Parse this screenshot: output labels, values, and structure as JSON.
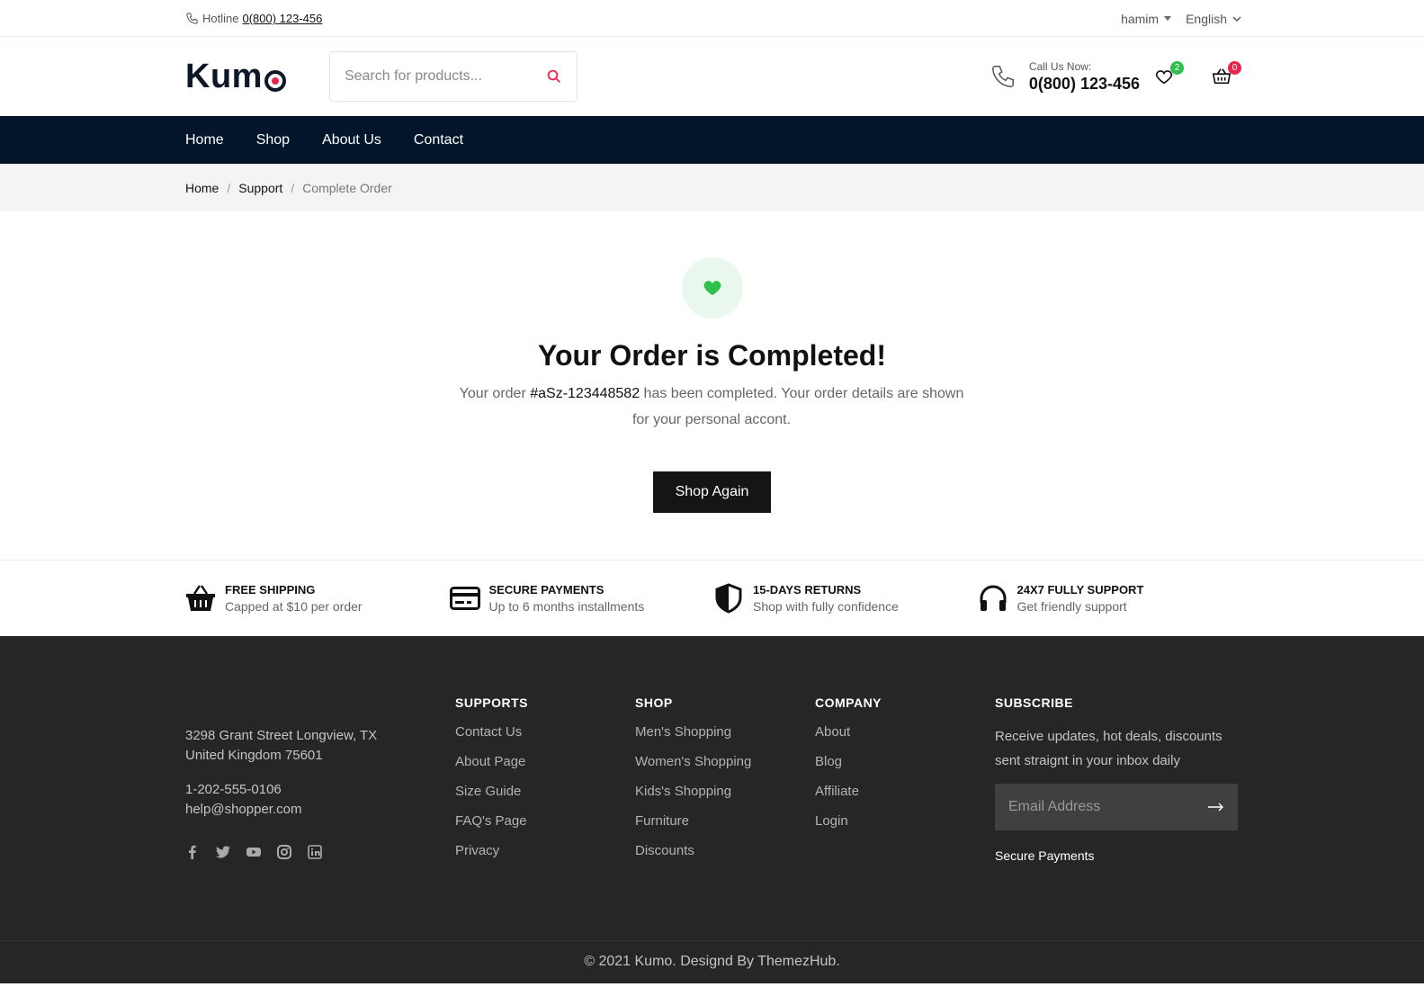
{
  "topbar": {
    "hotline_label": "Hotline",
    "hotline_number": "0(800) 123-456",
    "user": "hamim",
    "language": "English"
  },
  "header": {
    "logo": "Kum",
    "search_placeholder": "Search for products...",
    "call_label": "Call Us Now:",
    "call_number": "0(800) 123-456",
    "wishlist_count": "2",
    "cart_count": "0",
    "accent_color": "#e8254c"
  },
  "nav": {
    "items": [
      "Home",
      "Shop",
      "About Us",
      "Contact"
    ]
  },
  "breadcrumb": {
    "items": [
      "Home",
      "Support"
    ],
    "current": "Complete Order"
  },
  "main": {
    "title": "Your Order is Completed!",
    "msg_before": "Your order ",
    "order_id": "#aSz-123448582",
    "msg_after": " has been completed. Your order details are shown for your personal accont.",
    "button": "Shop Again",
    "heart_color": "#2ec04a"
  },
  "features": [
    {
      "title": "FREE SHIPPING",
      "subtitle": "Capped at $10 per order",
      "icon": "basket-icon"
    },
    {
      "title": "SECURE PAYMENTS",
      "subtitle": "Up to 6 months installments",
      "icon": "credit-card-icon"
    },
    {
      "title": "15-DAYS RETURNS",
      "subtitle": "Shop with fully confidence",
      "icon": "shield-icon"
    },
    {
      "title": "24X7 FULLY SUPPORT",
      "subtitle": "Get friendly support",
      "icon": "headphones-icon"
    }
  ],
  "footer": {
    "address_line1": "3298 Grant Street Longview, TX",
    "address_line2": "United Kingdom 75601",
    "phone": "1-202-555-0106",
    "email": "help@shopper.com",
    "columns": [
      {
        "title": "SUPPORTS",
        "items": [
          "Contact Us",
          "About Page",
          "Size Guide",
          "FAQ's Page",
          "Privacy"
        ]
      },
      {
        "title": "SHOP",
        "items": [
          "Men's Shopping",
          "Women's Shopping",
          "Kids's Shopping",
          "Furniture",
          "Discounts"
        ]
      },
      {
        "title": "COMPANY",
        "items": [
          "About",
          "Blog",
          "Affiliate",
          "Login"
        ]
      }
    ],
    "subscribe": {
      "title": "SUBSCRIBE",
      "text": "Receive updates, hot deals, discounts sent straignt in your inbox daily",
      "placeholder": "Email Address",
      "secure": "Secure Payments"
    },
    "copyright": "© 2021 Kumo. Designd By ThemezHub."
  }
}
